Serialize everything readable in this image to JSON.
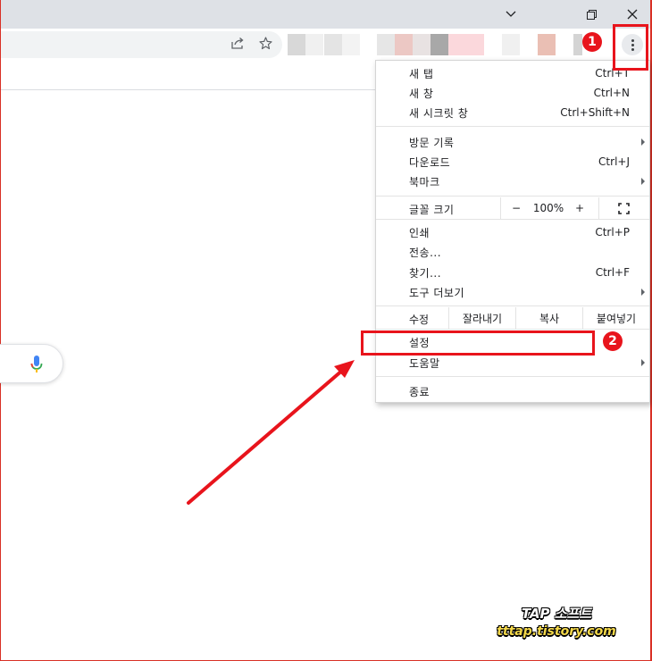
{
  "menu": {
    "section1": [
      {
        "label": "새 탭",
        "shortcut": "Ctrl+T"
      },
      {
        "label": "새 창",
        "shortcut": "Ctrl+N"
      },
      {
        "label": "새 시크릿 창",
        "shortcut": "Ctrl+Shift+N"
      }
    ],
    "section2": [
      {
        "label": "방문 기록",
        "shortcut": ""
      },
      {
        "label": "다운로드",
        "shortcut": "Ctrl+J"
      },
      {
        "label": "북마크",
        "shortcut": ""
      }
    ],
    "zoom": {
      "label": "글꼴 크기",
      "minus": "−",
      "value": "100%",
      "plus": "+"
    },
    "section4": [
      {
        "label": "인쇄",
        "shortcut": "Ctrl+P"
      },
      {
        "label": "전송...",
        "shortcut": ""
      },
      {
        "label": "찾기...",
        "shortcut": "Ctrl+F"
      },
      {
        "label": "도구 더보기",
        "shortcut": ""
      }
    ],
    "edit": {
      "label": "수정",
      "cut": "잘라내기",
      "copy": "복사",
      "paste": "붙여넣기"
    },
    "settings": {
      "label": "설정"
    },
    "help": {
      "label": "도움말"
    },
    "exit": {
      "label": "종료"
    }
  },
  "annotations": {
    "badge1": "1",
    "badge2": "2"
  },
  "watermark": {
    "line1": "TAP 소프트",
    "line2": "tttap.tistory.com"
  },
  "colors": {
    "annotation": "#e8141c",
    "titlebar": "#dee1e6",
    "omnibox": "#f1f3f4"
  }
}
